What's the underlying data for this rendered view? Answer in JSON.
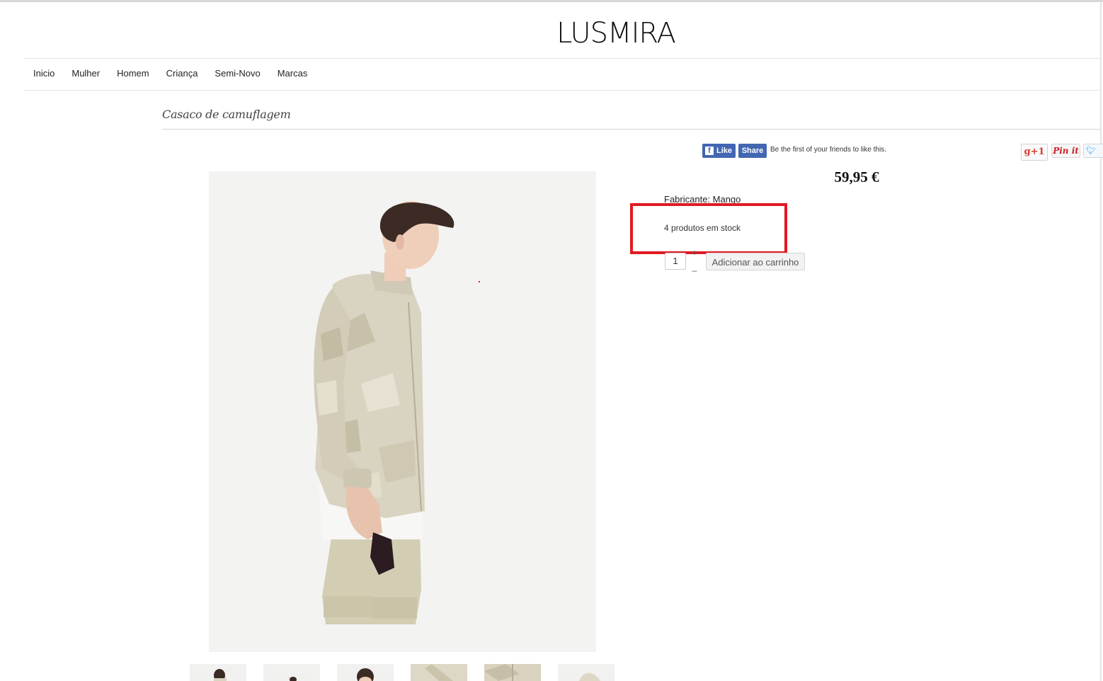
{
  "brand": {
    "logo_text": "LUSMIRA"
  },
  "nav": {
    "items": [
      {
        "label": "Inicio"
      },
      {
        "label": "Mulher"
      },
      {
        "label": "Homem"
      },
      {
        "label": "Criança"
      },
      {
        "label": "Semi-Novo"
      },
      {
        "label": "Marcas"
      }
    ]
  },
  "product": {
    "title": "Casaco de camuflagem",
    "price": "59,95 €",
    "manufacturer": "Fabricante: Mango",
    "stock": "4 produtos em stock",
    "quantity": "1",
    "qty_plus": "+",
    "qty_minus": "_",
    "add_to_cart_label": "Adicionar ao carrinho",
    "thumbnail_count": 6
  },
  "social": {
    "fb_like_label": "Like",
    "fb_share_label": "Share",
    "fb_note": "Be the first of your friends to like this.",
    "gplus_label": "g+1",
    "pinit_label": "Pin it",
    "tweet_label": "Tw"
  },
  "colors": {
    "highlight": "#e01a24",
    "facebook": "#4267b2",
    "jacket": "#d9d4c2",
    "shorts": "#d0cbb0"
  }
}
